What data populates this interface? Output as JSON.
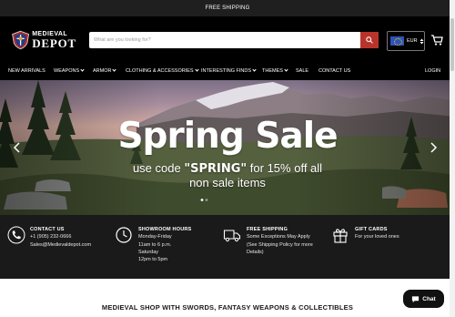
{
  "announcement": "FREE SHIPPING",
  "logo": {
    "line1": "MEDIEVAL",
    "line2": "DEPOT"
  },
  "search": {
    "placeholder": "What are you looking for?"
  },
  "currency": {
    "code": "EUR"
  },
  "nav": {
    "items": [
      "NEW ARRIVALS",
      "WEAPONS",
      "ARMOR",
      "CLOTHING & ACCESSORIES",
      "INTERESTING FINDS",
      "THEMES",
      "SALE",
      "CONTACT US"
    ],
    "login": "LOGIN"
  },
  "hero": {
    "headline": "Spring Sale",
    "line1_prefix": "use code",
    "line1_code": "\"SPRING\"",
    "line1_suffix": "for 15% off all",
    "line2": "non sale items"
  },
  "features": [
    {
      "icon": "phone-icon",
      "title": "CONTACT US",
      "lines": [
        "+1 (905) 232-0666",
        "Sales@Medievaldepot.com"
      ]
    },
    {
      "icon": "clock-icon",
      "title": "SHOWROOM HOURS",
      "lines": [
        "Monday-Friday",
        "11am to 6 p.m.",
        "Saturday",
        "12pm to 5pm"
      ]
    },
    {
      "icon": "truck-icon",
      "title": "FREE SHIPPING",
      "lines": [
        "Some Exceptions May Apply",
        "(See Shipping Policy for more",
        "Details)"
      ]
    },
    {
      "icon": "gift-icon",
      "title": "GIFT CARDS",
      "lines": [
        "For your loved ones"
      ]
    }
  ],
  "section_title": "MEDIEVAL SHOP WITH SWORDS, FANTASY WEAPONS & COLLECTIBLES",
  "chat": {
    "label": "Chat"
  },
  "colors": {
    "header": "#000000",
    "topbar": "#1f1f1f",
    "search_button": "#b8342a",
    "features_bg": "#1a1a1a"
  }
}
